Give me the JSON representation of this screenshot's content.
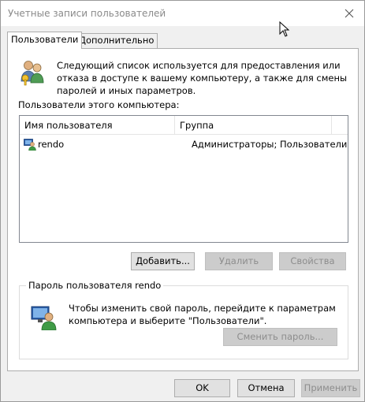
{
  "window": {
    "title": "Учетные записи пользователей"
  },
  "tabs": [
    {
      "label": "Пользователи",
      "active": true
    },
    {
      "label": "Дополнительно",
      "active": false
    }
  ],
  "users_tab": {
    "intro_text": "Следующий список используется для предоставления или отказа в доступе к вашему компьютеру, а также для смены паролей и иных параметров.",
    "users_label": "Пользователи этого компьютера:",
    "columns": [
      "Имя пользователя",
      "Группа"
    ],
    "rows": [
      {
        "user": "rendo",
        "group": "Администраторы; Пользователи",
        "icon": "user-admin-icon"
      }
    ],
    "add_button": "Добавить...",
    "remove_button": "Удалить",
    "properties_button": "Свойства",
    "password_group": {
      "title": "Пароль пользователя rendo",
      "text": "Чтобы изменить свой пароль, перейдите к параметрам компьютера и выберите \"Пользователи\".",
      "change_button": "Сменить пароль..."
    }
  },
  "footer": {
    "ok": "OK",
    "cancel": "Отмена",
    "apply": "Применить"
  },
  "colors": {
    "window_bg": "#f0f0f0",
    "panel_bg": "#ffffff",
    "disabled_text": "#8d8d8d"
  }
}
